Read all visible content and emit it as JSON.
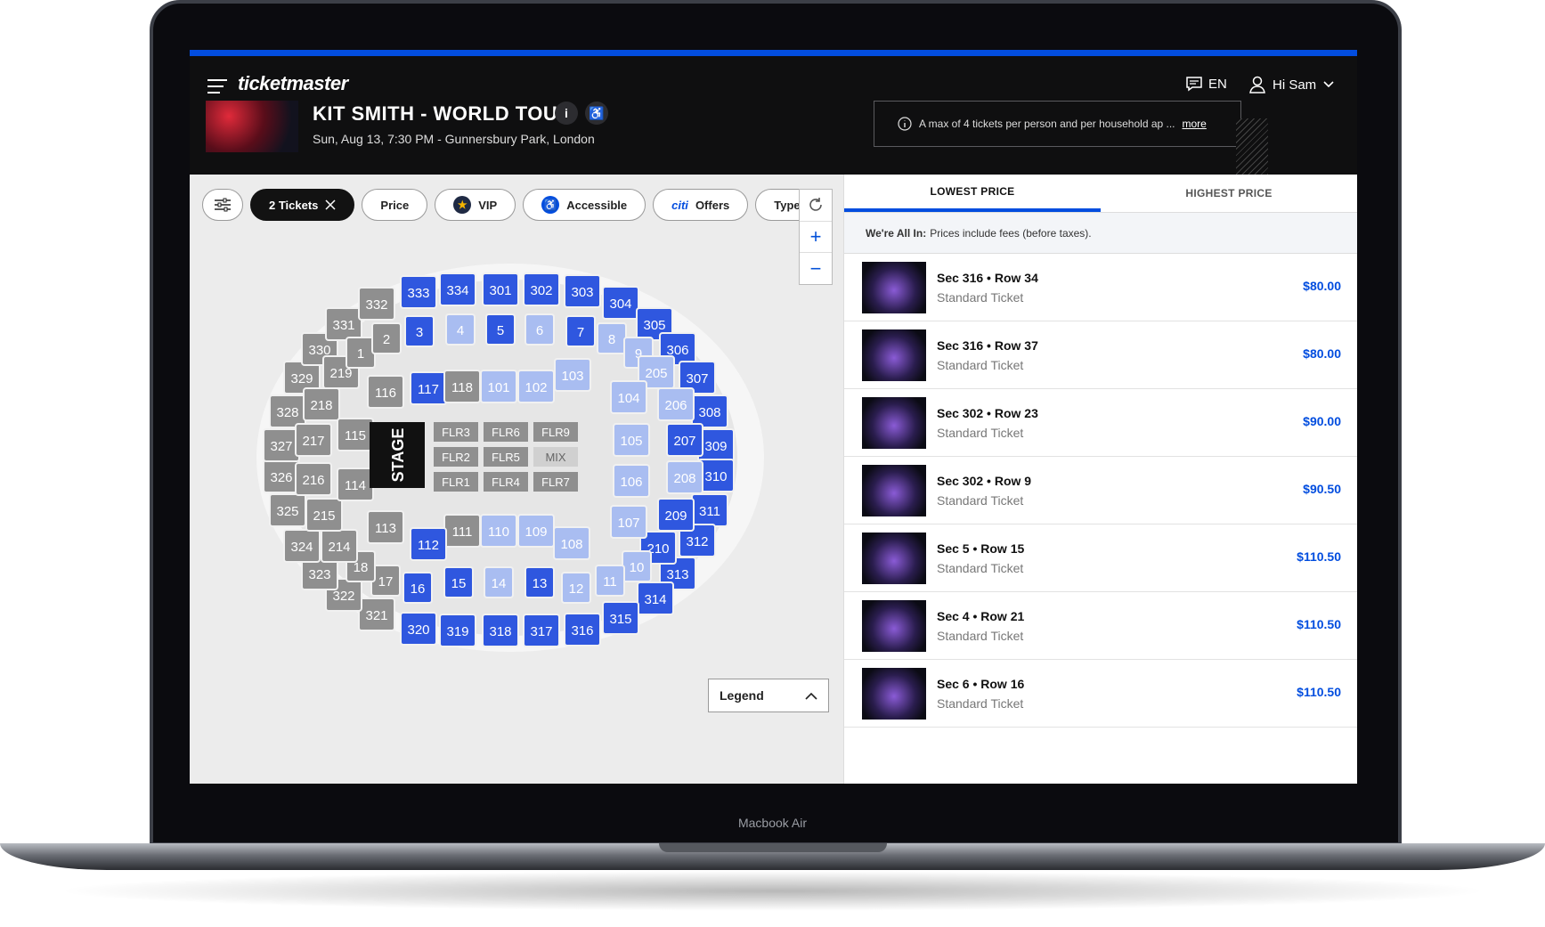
{
  "device": {
    "label": "Macbook Air"
  },
  "header": {
    "brand": "ticketmaster",
    "language": "EN",
    "user_greeting": "Hi Sam",
    "event_title": "KIT SMITH - WORLD TOUR",
    "event_subtitle": "Sun, Aug 13, 7:30 PM - Gunnersbury Park, London",
    "info_label": "i",
    "notice_text": "A max of 4 tickets per person and per household ap ...",
    "notice_more": "more"
  },
  "filters": {
    "tickets": "2 Tickets",
    "price": "Price",
    "vip": "VIP",
    "accessible": "Accessible",
    "offers_brand": "citi",
    "offers": "Offers",
    "type": "Type"
  },
  "map": {
    "stage_label": "STAGE",
    "legend_label": "Legend",
    "floor": [
      "FLR3",
      "FLR6",
      "FLR9",
      "FLR2",
      "FLR5",
      "MIX",
      "FLR1",
      "FLR4",
      "FLR7"
    ],
    "sections": [
      "333",
      "334",
      "301",
      "302",
      "303",
      "304",
      "305",
      "306",
      "307",
      "308",
      "309",
      "310",
      "311",
      "312",
      "313",
      "314",
      "315",
      "316",
      "317",
      "318",
      "319",
      "320",
      "321",
      "322",
      "323",
      "324",
      "325",
      "326",
      "327",
      "328",
      "329",
      "330",
      "331",
      "332",
      "3",
      "4",
      "5",
      "6",
      "7",
      "8",
      "9",
      "205",
      "206",
      "207",
      "208",
      "209",
      "210",
      "10",
      "11",
      "12",
      "13",
      "14",
      "15",
      "16",
      "17",
      "18",
      "214",
      "215",
      "216",
      "217",
      "218",
      "219",
      "1",
      "2",
      "117",
      "118",
      "101",
      "102",
      "103",
      "104",
      "105",
      "106",
      "107",
      "108",
      "109",
      "110",
      "111",
      "112",
      "113",
      "114",
      "115",
      "116"
    ]
  },
  "results": {
    "tab_low": "LOWEST PRICE",
    "tab_high": "HIGHEST PRICE",
    "allin_bold": "We're All In:",
    "allin_text": "Prices include fees (before taxes).",
    "items": [
      {
        "section": "Sec 316 • Row 34",
        "type": "Standard Ticket",
        "price": "$80.00"
      },
      {
        "section": "Sec 316 • Row 37",
        "type": "Standard Ticket",
        "price": "$80.00"
      },
      {
        "section": "Sec 302 • Row 23",
        "type": "Standard Ticket",
        "price": "$90.00"
      },
      {
        "section": "Sec 302 • Row 9",
        "type": "Standard Ticket",
        "price": "$90.50"
      },
      {
        "section": "Sec 5 • Row 15",
        "type": "Standard Ticket",
        "price": "$110.50"
      },
      {
        "section": "Sec 4 • Row 21",
        "type": "Standard Ticket",
        "price": "$110.50"
      },
      {
        "section": "Sec 6 • Row 16",
        "type": "Standard Ticket",
        "price": "$110.50"
      }
    ]
  },
  "colors": {
    "accent": "#024ddf",
    "unavailable": "#8f8f8f"
  }
}
